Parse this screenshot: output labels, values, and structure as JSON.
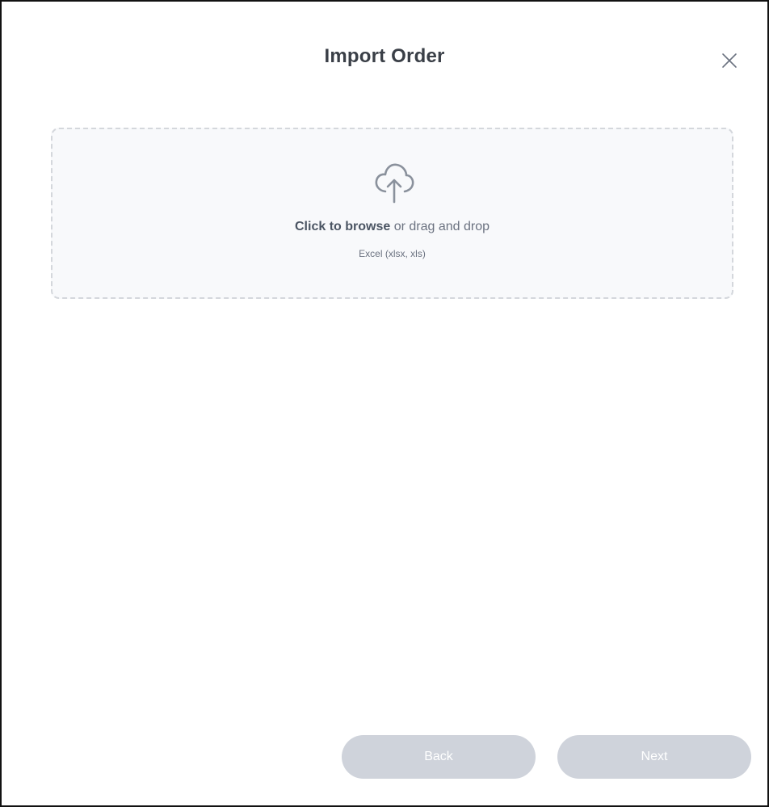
{
  "dialog": {
    "title": "Import Order",
    "close_icon": "close-icon"
  },
  "dropzone": {
    "icon": "cloud-upload-icon",
    "browse_label": "Click to browse",
    "drag_label": " or drag and drop",
    "formats_hint": "Excel (xlsx, xls)"
  },
  "footer": {
    "back_label": "Back",
    "next_label": "Next"
  },
  "colors": {
    "title_text": "#3a3f47",
    "dropzone_bg": "#f8f9fb",
    "dropzone_border": "#d4d7dc",
    "button_disabled_bg": "#cfd3db",
    "button_text": "#ffffff"
  }
}
